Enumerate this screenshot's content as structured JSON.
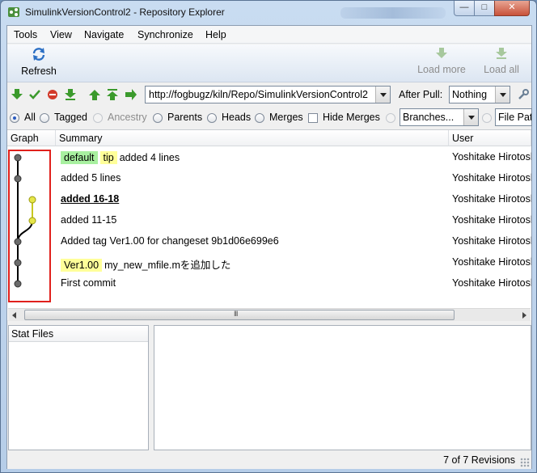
{
  "window": {
    "title": "SimulinkVersionControl2 - Repository Explorer"
  },
  "menu": [
    "Tools",
    "View",
    "Navigate",
    "Synchronize",
    "Help"
  ],
  "toolbar": {
    "refresh": "Refresh",
    "load_more": "Load more",
    "load_all": "Load all"
  },
  "sync": {
    "url": "http://fogbugz/kiln/Repo/SimulinkVersionControl2",
    "after_pull_label": "After Pull:",
    "after_pull_value": "Nothing"
  },
  "filters": {
    "all": "All",
    "tagged": "Tagged",
    "ancestry": "Ancestry",
    "parents": "Parents",
    "heads": "Heads",
    "merges": "Merges",
    "hide_merges": "Hide Merges",
    "branches": "Branches...",
    "file_pattern": "File Pattern"
  },
  "grid": {
    "columns": [
      "Graph",
      "Summary",
      "User"
    ],
    "rows": [
      {
        "tags": [
          {
            "text": "default",
            "color": "#a8f0a0"
          },
          {
            "text": "tip",
            "color": "#ffff99"
          }
        ],
        "summary": "added 4 lines",
        "user": "Yoshitake Hirotoshi",
        "bold": false,
        "lane": 0,
        "color": "#6b6b6b"
      },
      {
        "tags": [],
        "summary": "added 5 lines",
        "user": "Yoshitake Hirotoshi",
        "bold": false,
        "lane": 0,
        "color": "#6b6b6b"
      },
      {
        "tags": [],
        "summary": "added 16-18",
        "user": "Yoshitake Hirotoshi",
        "bold": true,
        "lane": 1,
        "color": "#e6e64a"
      },
      {
        "tags": [],
        "summary": "added 11-15",
        "user": "Yoshitake Hirotoshi",
        "bold": false,
        "lane": 1,
        "color": "#e6e64a"
      },
      {
        "tags": [],
        "summary": "Added tag Ver1.00 for changeset 9b1d06e699e6",
        "user": "Yoshitake Hirotoshi",
        "bold": false,
        "lane": 0,
        "color": "#6b6b6b"
      },
      {
        "tags": [
          {
            "text": "Ver1.00",
            "color": "#ffff99"
          }
        ],
        "summary": "my_new_mfile.mを追加した",
        "user": "Yoshitake Hirotoshi",
        "bold": false,
        "lane": 0,
        "color": "#6b6b6b"
      },
      {
        "tags": [],
        "summary": "First commit",
        "user": "Yoshitake Hirotoshi",
        "bold": false,
        "lane": 0,
        "color": "#6b6b6b"
      }
    ]
  },
  "panes": {
    "stat_files": "Stat Files"
  },
  "status": {
    "revisions": "7 of 7 Revisions"
  }
}
